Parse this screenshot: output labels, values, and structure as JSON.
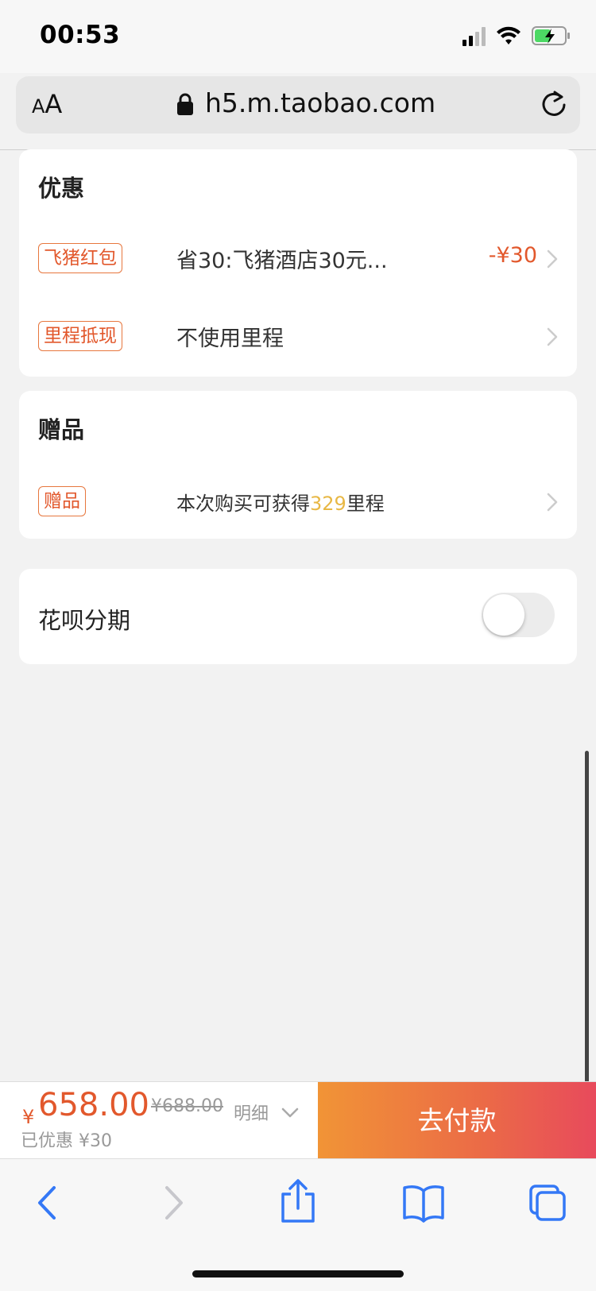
{
  "status": {
    "time": "00:53"
  },
  "browser": {
    "aa_small": "A",
    "aa_large": "A",
    "url": "h5.m.taobao.com"
  },
  "discount_card": {
    "title": "优惠",
    "rows": [
      {
        "tag": "飞猪红包",
        "text": "省30:飞猪酒店30元...",
        "amount": "-¥30"
      },
      {
        "tag": "里程抵现",
        "text": "不使用里程"
      }
    ]
  },
  "gift_card": {
    "title": "赠品",
    "row": {
      "tag": "赠品",
      "text_before": "本次购买可获得",
      "miles": "329",
      "text_after": "里程"
    }
  },
  "installment": {
    "label": "花呗分期",
    "enabled": false
  },
  "checkout": {
    "currency": "¥",
    "price": "658.00",
    "original_price": "¥688.00",
    "detail_label": "明细",
    "saved_text": "已优惠 ¥30",
    "pay_label": "去付款"
  },
  "colors": {
    "accent": "#e2582c",
    "highlight": "#e8b845",
    "ios_blue": "#3478f6"
  }
}
